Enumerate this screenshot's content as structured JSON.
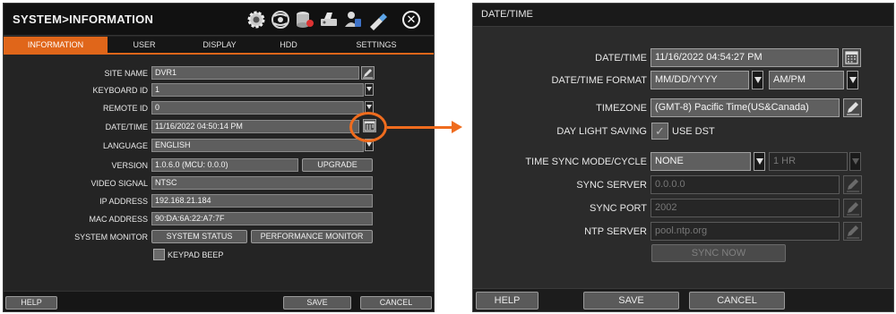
{
  "left": {
    "title": "SYSTEM>INFORMATION",
    "toolbar_icons": [
      "gear-icon",
      "network-icon",
      "storage-icon",
      "device-icon",
      "user-icon",
      "usb-icon"
    ],
    "tabs": [
      "INFORMATION",
      "USER",
      "DISPLAY",
      "HDD",
      "SETTINGS"
    ],
    "active_tab": "INFORMATION",
    "fields": {
      "site_name": {
        "label": "SITE NAME",
        "value": "DVR1"
      },
      "keyboard_id": {
        "label": "KEYBOARD ID",
        "value": "1"
      },
      "remote_id": {
        "label": "REMOTE ID",
        "value": "0"
      },
      "date_time": {
        "label": "DATE/TIME",
        "value": "11/16/2022 04:50:14 PM"
      },
      "language": {
        "label": "LANGUAGE",
        "value": "ENGLISH"
      },
      "version": {
        "label": "VERSION",
        "value": "1.0.6.0 (MCU: 0.0.0)"
      },
      "video_signal": {
        "label": "VIDEO SIGNAL",
        "value": "NTSC"
      },
      "ip_address": {
        "label": "IP ADDRESS",
        "value": "192.168.21.184"
      },
      "mac_address": {
        "label": "MAC ADDRESS",
        "value": "90:DA:6A:22:A7:7F"
      },
      "system_monitor": {
        "label": "SYSTEM MONITOR"
      }
    },
    "buttons": {
      "upgrade": "UPGRADE",
      "system_status": "SYSTEM STATUS",
      "performance_monitor": "PERFORMANCE MONITOR"
    },
    "keypad_beep": {
      "label": "KEYPAD BEEP",
      "checked": false
    },
    "footer": {
      "help": "HELP",
      "save": "SAVE",
      "cancel": "CANCEL"
    },
    "highlight_color": "#ef6c1e"
  },
  "right": {
    "title": "DATE/TIME",
    "date_time": {
      "label": "DATE/TIME",
      "value": "11/16/2022 04:54:27 PM"
    },
    "date_time_format": {
      "label": "DATE/TIME FORMAT",
      "date_format": "MM/DD/YYYY",
      "time_format": "AM/PM"
    },
    "timezone": {
      "label": "TIMEZONE",
      "value": "(GMT-8) Pacific Time(US&Canada)"
    },
    "daylight_saving": {
      "label": "DAY LIGHT SAVING",
      "option": "USE DST",
      "checked": true
    },
    "time_sync": {
      "label": "TIME SYNC MODE/CYCLE",
      "mode": "NONE",
      "cycle": "1 HR"
    },
    "sync_server": {
      "label": "SYNC SERVER",
      "value": "0.0.0.0"
    },
    "sync_port": {
      "label": "SYNC PORT",
      "value": "2002"
    },
    "ntp_server": {
      "label": "NTP SERVER",
      "value": "pool.ntp.org"
    },
    "sync_now": "SYNC NOW",
    "footer": {
      "help": "HELP",
      "save": "SAVE",
      "cancel": "CANCEL"
    }
  }
}
